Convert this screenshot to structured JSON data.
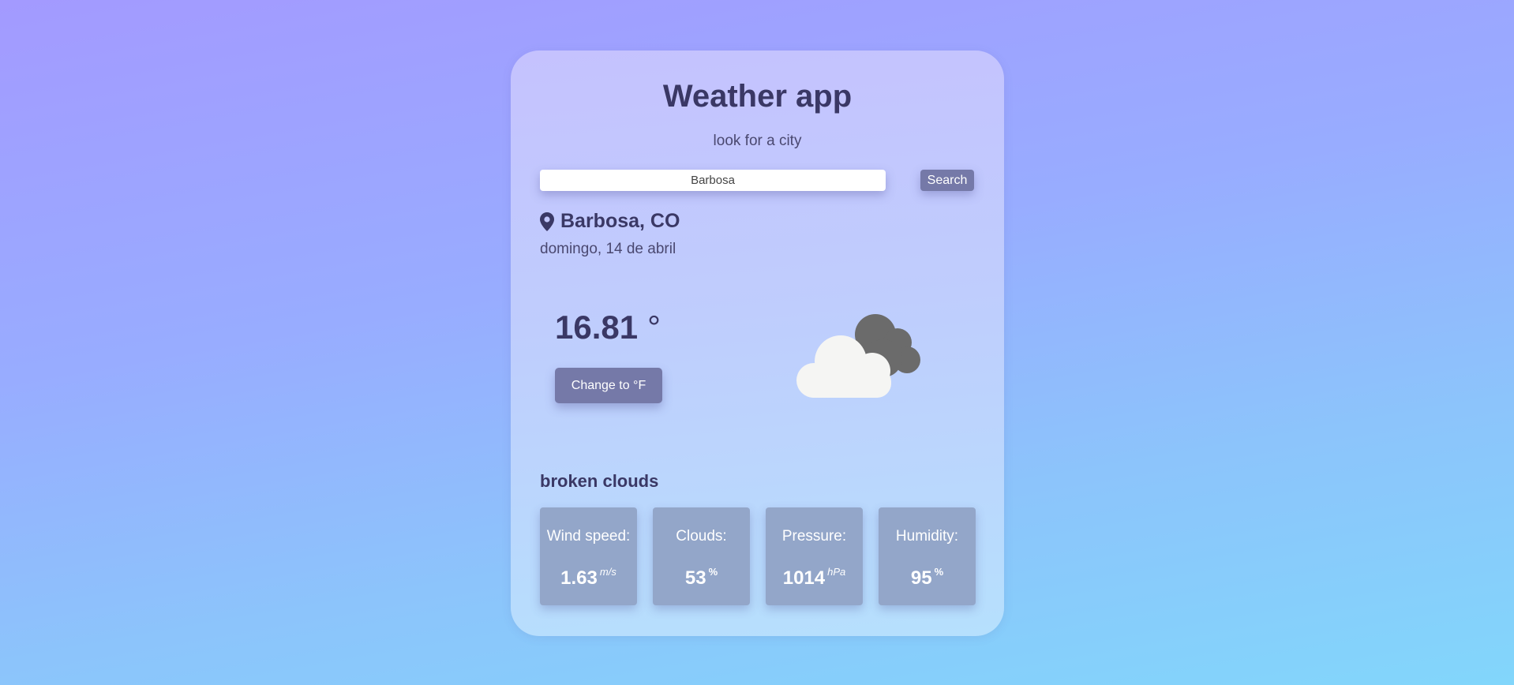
{
  "app": {
    "title": "Weather app",
    "subtitle": "look for a city"
  },
  "search": {
    "value": "Barbosa",
    "button_label": "Search"
  },
  "location": {
    "icon": "map-pin-icon",
    "city": "Barbosa, CO",
    "date": "domingo, 14 de abril"
  },
  "current": {
    "temperature": "16.81",
    "degree_symbol": "°",
    "unit_toggle_label": "Change to °F",
    "weather_icon": "broken-clouds-icon",
    "description": "broken clouds"
  },
  "stats": [
    {
      "label": "Wind speed:",
      "value": "1.63",
      "unit": "m/s"
    },
    {
      "label": "Clouds:",
      "value": "53",
      "unit": "%"
    },
    {
      "label": "Pressure:",
      "value": "1014",
      "unit": "hPa"
    },
    {
      "label": "Humidity:",
      "value": "95",
      "unit": "%"
    }
  ],
  "colors": {
    "accent": "#7579a8",
    "text_dark": "#3a3865",
    "stat_box": "#93a6c9",
    "cloud_light": "#f5f5f3",
    "cloud_dark": "#6b6b6b"
  }
}
